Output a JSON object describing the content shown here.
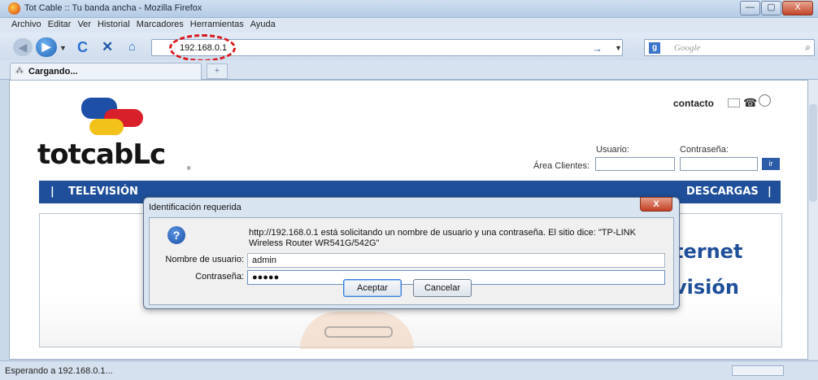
{
  "window": {
    "title": "Tot Cable :: Tu banda ancha - Mozilla Firefox",
    "buttons": {
      "minimize": "—",
      "maximize": "▢",
      "close": "X"
    }
  },
  "menubar": [
    "Archivo",
    "Editar",
    "Ver",
    "Historial",
    "Marcadores",
    "Herramientas",
    "Ayuda"
  ],
  "navbar": {
    "url": "192.168.0.1",
    "search_placeholder": "Google"
  },
  "tabs": [
    {
      "label": "Cargando..."
    }
  ],
  "page": {
    "contact_label": "contacto",
    "clientes_label": "Área Clientes:",
    "usuario_label": "Usuario:",
    "password_label": "Contraseña:",
    "ir_label": "ir",
    "nav_left": "TELEVISIÓN",
    "nav_right": "DESCARGAS",
    "banner_line1": "ternet",
    "banner_line2": "visión"
  },
  "dialog": {
    "title": "Identificación requerida",
    "message": "http://192.168.0.1 está solicitando un nombre de usuario y una contraseña. El sitio dice: \"TP-LINK Wireless Router WR541G/542G\"",
    "username_label": "Nombre de usuario:",
    "username_value": "admin",
    "password_label": "Contraseña:",
    "password_value": "●●●●●",
    "ok_label": "Aceptar",
    "cancel_label": "Cancelar"
  },
  "status": {
    "text": "Esperando a 192.168.0.1..."
  }
}
